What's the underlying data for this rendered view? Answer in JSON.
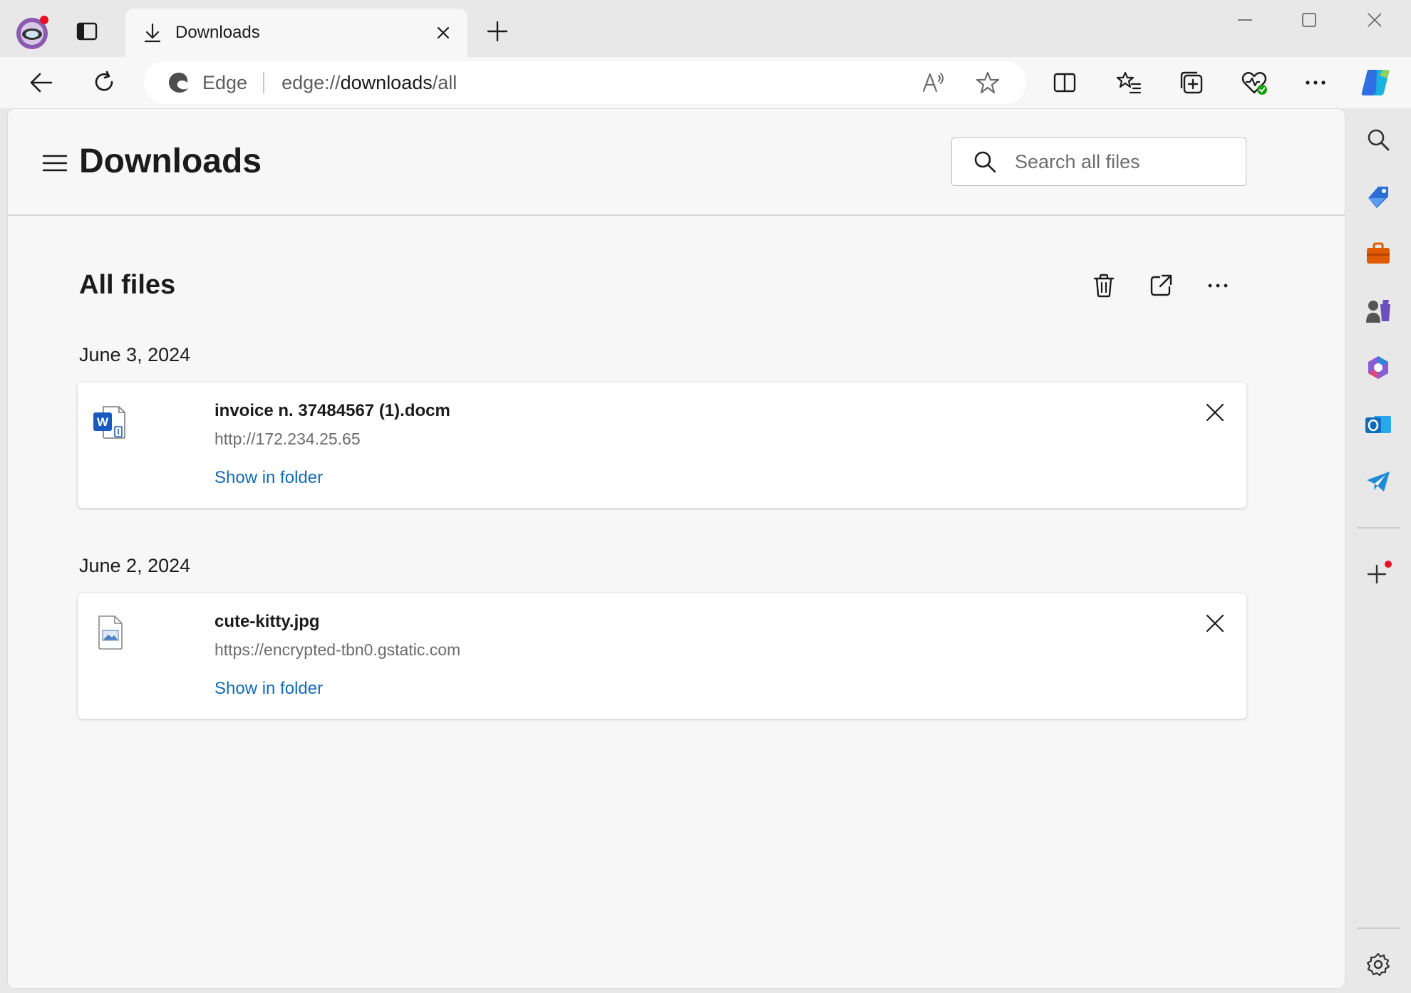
{
  "window": {
    "tab": {
      "title": "Downloads",
      "icon": "download-icon"
    },
    "controls": [
      "minimize-icon",
      "maximize-icon",
      "close-icon"
    ]
  },
  "toolbar": {
    "address": {
      "site_label": "Edge",
      "url_scheme": "edge://",
      "url_host": "downloads",
      "url_path": "/all"
    },
    "icons": [
      "back-icon",
      "refresh-icon",
      "read-aloud-icon",
      "favorite-star-icon",
      "split-screen-icon",
      "favorites-icon",
      "collections-icon",
      "browser-essentials-icon",
      "more-icon",
      "copilot-icon"
    ]
  },
  "page": {
    "title": "Downloads",
    "search": {
      "placeholder": "Search all files",
      "value": ""
    },
    "section_title": "All files",
    "groups": [
      {
        "date": "June 3, 2024",
        "items": [
          {
            "name": "invoice n. 37484567 (1).docm",
            "url": "http://172.234.25.65",
            "action": "Show in folder",
            "icon": "word-document-icon"
          }
        ]
      },
      {
        "date": "June 2, 2024",
        "items": [
          {
            "name": "cute-kitty.jpg",
            "url": "https://encrypted-tbn0.gstatic.com",
            "action": "Show in folder",
            "icon": "image-file-icon"
          }
        ]
      }
    ]
  },
  "sidebar": {
    "items": [
      "search-icon",
      "shopping-tag-icon",
      "tools-icon",
      "games-icon",
      "microsoft365-icon",
      "outlook-icon",
      "telegram-icon",
      "add-icon",
      "settings-icon"
    ],
    "accent_colors": {
      "link": "#0f6cbd",
      "notification_dot": "#e81123",
      "tools": "#e05a00"
    }
  }
}
